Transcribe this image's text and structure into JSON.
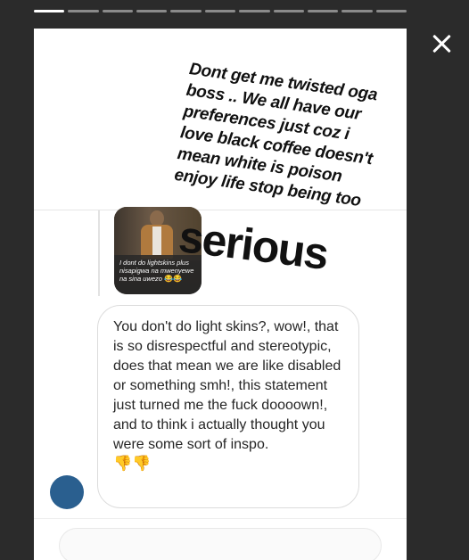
{
  "story": {
    "progress_segments": 11,
    "active_segment": 0,
    "close_icon": "close-icon"
  },
  "caption": {
    "line1": "Dont get me twisted oga",
    "line2": "boss .. We all have our",
    "line3": "preferences just coz i",
    "line4": "love black coffee doesn't",
    "line5": "mean white is poison",
    "line6": "enjoy life stop being too",
    "emphasis": "serious"
  },
  "shared_post": {
    "text": "I dont do lightskins plus nisapigwa na mwenyewe na sina uwezo",
    "emoji": "😂😂"
  },
  "message": {
    "text": "You don't do light skins?, wow!, that is so disrespectful and stereotypic, does that mean we are like disabled or something smh!, this statement just turned me the fuck doooown!, and to think i actually thought you were some sort of inspo.",
    "emoji": "👎👎"
  },
  "colors": {
    "background": "#2b2b2b",
    "card": "#ffffff",
    "avatar": "#2a5f8f",
    "text": "#262626"
  }
}
